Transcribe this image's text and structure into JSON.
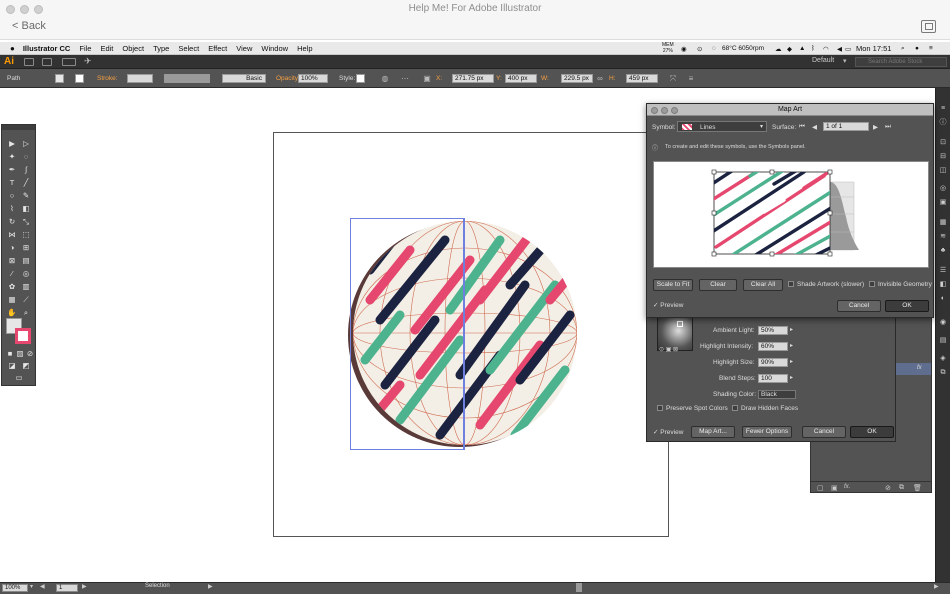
{
  "window": {
    "title": "Help Me! For Adobe Illustrator",
    "back_label": "< Back"
  },
  "menubar": {
    "app_name": "Illustrator CC",
    "items": [
      "File",
      "Edit",
      "Object",
      "Type",
      "Select",
      "Effect",
      "View",
      "Window",
      "Help"
    ],
    "status": {
      "mem_label": "MEM",
      "mem_value": "27%",
      "temp": "68°C 6050rpm",
      "time": "Mon 17:51"
    }
  },
  "appbar": {
    "logo": "Ai",
    "workspace": "Default",
    "search_placeholder": "Search Adobe Stock"
  },
  "control_bar": {
    "selection_type": "Path",
    "stroke_label": "Stroke:",
    "brush_label": "Basic",
    "opacity_label": "Opacity:",
    "opacity_value": "100%",
    "style_label": "Style:",
    "x_label": "X:",
    "x_value": "271.75 px",
    "y_label": "Y:",
    "y_value": "400 px",
    "w_label": "W:",
    "w_value": "229.5 px",
    "h_label": "H:",
    "h_value": "459 px"
  },
  "map_art": {
    "title": "Map Art",
    "symbol_label": "Symbol:",
    "symbol_value": "Lines",
    "surface_label": "Surface:",
    "surface_value": "1 of 1",
    "info": "To create and edit these symbols, use the Symbols panel.",
    "buttons": {
      "scale_to_fit": "Scale to Fit",
      "clear": "Clear",
      "clear_all": "Clear All",
      "cancel": "Cancel",
      "ok": "OK"
    },
    "shade_artwork": "Shade Artwork (slower)",
    "invisible_geometry": "Invisible Geometry",
    "preview": "Preview"
  },
  "options_3d": {
    "ambient_light_label": "Ambient Light:",
    "ambient_light": "50%",
    "highlight_intensity_label": "Highlight Intensity:",
    "highlight_intensity": "60%",
    "highlight_size_label": "Highlight Size:",
    "highlight_size": "90%",
    "blend_steps_label": "Blend Steps:",
    "blend_steps": "100",
    "shading_color_label": "Shading Color:",
    "shading_color": "Black",
    "preserve_spot": "Preserve Spot Colors",
    "draw_hidden": "Draw Hidden Faces",
    "preview": "Preview",
    "buttons": {
      "map_art": "Map Art...",
      "fewer_options": "Fewer Options",
      "cancel": "Cancel",
      "ok": "OK"
    }
  },
  "status_bar": {
    "zoom": "100%",
    "artboard": "1",
    "tool": "Selection"
  },
  "colors": {
    "navy": "#1c2340",
    "green": "#4db38f",
    "pink": "#e5476e",
    "sphere": "#f3efe6",
    "grid": "#d0694f"
  }
}
